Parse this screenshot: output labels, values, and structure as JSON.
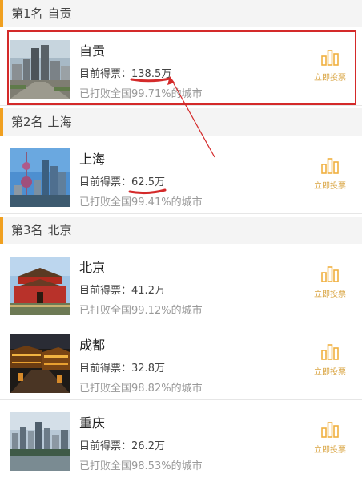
{
  "ranks": [
    {
      "header": "第1名",
      "city": "自贡"
    },
    {
      "header": "第2名",
      "city": "上海"
    },
    {
      "header": "第3名",
      "city": "北京"
    }
  ],
  "vote_label": "立即投票",
  "votes_prefix": "目前得票：",
  "items": [
    {
      "name": "自贡",
      "votes": "138.5万",
      "beat": "已打败全国99.71%的城市",
      "image": "city-skyline-photo"
    },
    {
      "name": "上海",
      "votes": "62.5万",
      "beat": "已打败全国99.41%的城市",
      "image": "oriental-pearl-tower-photo"
    },
    {
      "name": "北京",
      "votes": "41.2万",
      "beat": "已打败全国99.12%的城市",
      "image": "tiananmen-photo"
    },
    {
      "name": "成都",
      "votes": "32.8万",
      "beat": "已打败全国98.82%的城市",
      "image": "night-street-photo"
    },
    {
      "name": "重庆",
      "votes": "26.2万",
      "beat": "已打败全国98.53%的城市",
      "image": "river-city-photo"
    }
  ],
  "colors": {
    "accent": "#f0a020",
    "annotation": "#d42a2a",
    "vote_icon": "#f0b040"
  },
  "icons": {
    "vote": "bar-chart-icon"
  }
}
